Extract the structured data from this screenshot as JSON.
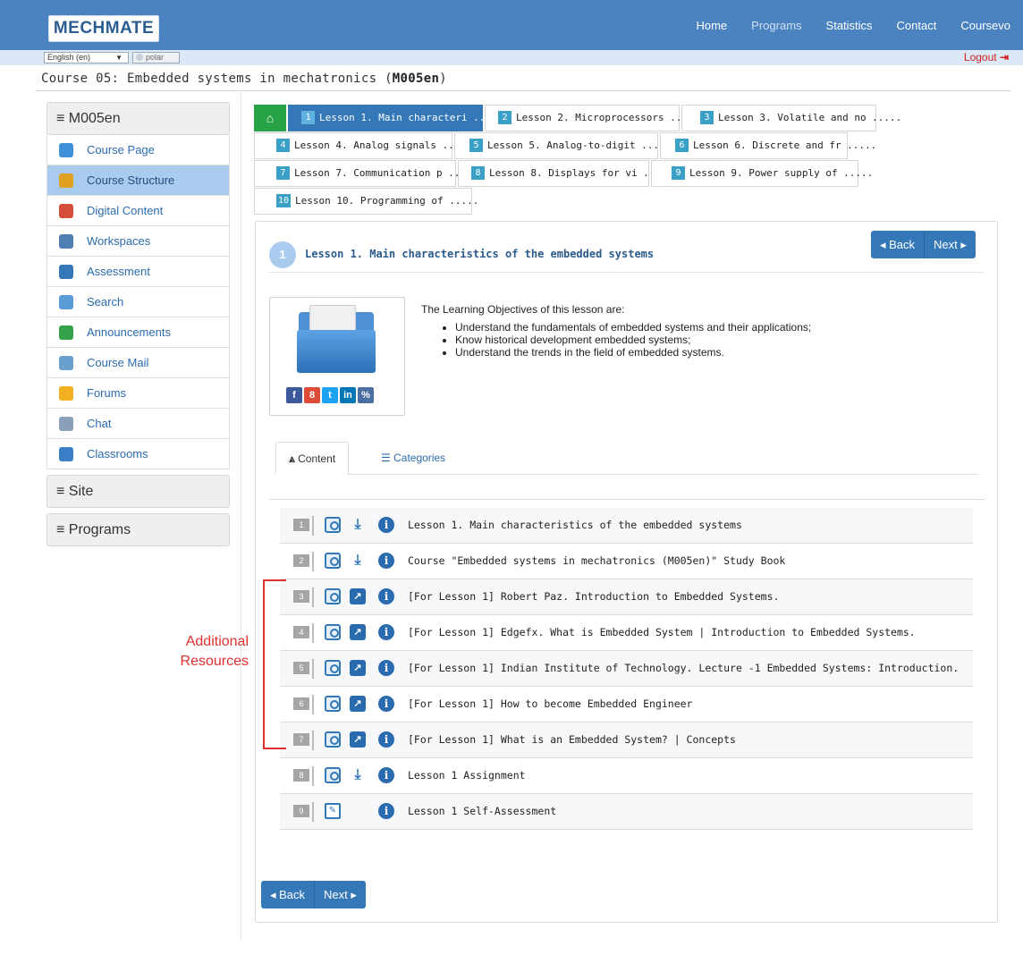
{
  "header": {
    "logo_part1": "MECH",
    "logo_part2": "MATE",
    "nav": [
      "Home",
      "Programs",
      "Statistics",
      "Contact",
      "Coursevo"
    ]
  },
  "subbar": {
    "language": "English (en)",
    "theme": "polar",
    "logout": "Logout"
  },
  "course": {
    "title_prefix": "Course 05: Embedded systems in mechatronics (",
    "code": "M005en",
    "title_suffix": ")"
  },
  "sidebar": {
    "course_header": "≡ M005en",
    "items": [
      {
        "label": "Course Page",
        "icon_color": "#3d8fd6"
      },
      {
        "label": "Course Structure",
        "icon_color": "#e0a020"
      },
      {
        "label": "Digital Content",
        "icon_color": "#d44f3a"
      },
      {
        "label": "Workspaces",
        "icon_color": "#4e7fb3"
      },
      {
        "label": "Assessment",
        "icon_color": "#3478b8"
      },
      {
        "label": "Search",
        "icon_color": "#5a9bd6"
      },
      {
        "label": "Announcements",
        "icon_color": "#35a04a"
      },
      {
        "label": "Course Mail",
        "icon_color": "#6aa0d0"
      },
      {
        "label": "Forums",
        "icon_color": "#f0b020"
      },
      {
        "label": "Chat",
        "icon_color": "#8aa0b8"
      },
      {
        "label": "Classrooms",
        "icon_color": "#3a7ec6"
      }
    ],
    "site_header": "≡ Site",
    "programs_header": "≡ Programs"
  },
  "lesson_tabs": [
    {
      "num": "1",
      "label": "Lesson 1. Main characteri ....."
    },
    {
      "num": "2",
      "label": "Lesson 2. Microprocessors ....."
    },
    {
      "num": "3",
      "label": "Lesson 3. Volatile and no ....."
    },
    {
      "num": "4",
      "label": "Lesson 4. Analog signals ....."
    },
    {
      "num": "5",
      "label": "Lesson 5. Analog-to-digit ....."
    },
    {
      "num": "6",
      "label": "Lesson 6. Discrete and fr ....."
    },
    {
      "num": "7",
      "label": "Lesson 7. Communication p ....."
    },
    {
      "num": "8",
      "label": "Lesson 8. Displays for vi ....."
    },
    {
      "num": "9",
      "label": "Lesson 9. Power supply of ....."
    },
    {
      "num": "10",
      "label": "Lesson 10. Programming of ....."
    }
  ],
  "lesson": {
    "badge": "1",
    "title": "Lesson 1. Main characteristics of the embedded systems",
    "back": "◂ Back",
    "next": "Next ▸",
    "objectives_intro": "The Learning Objectives of this lesson are:",
    "objectives": [
      "Understand the fundamentals of embedded systems and their applications;",
      "Know historical development embedded systems;",
      "Understand the trends in the field of embedded systems."
    ],
    "socials": [
      {
        "glyph": "f",
        "color": "#3b5998",
        "name": "facebook-icon"
      },
      {
        "glyph": "8",
        "color": "#dd4b39",
        "name": "google-plus-icon"
      },
      {
        "glyph": "t",
        "color": "#1da1f2",
        "name": "twitter-icon"
      },
      {
        "glyph": "in",
        "color": "#0077b5",
        "name": "linkedin-icon"
      },
      {
        "glyph": "%",
        "color": "#4a6fa0",
        "name": "link-icon"
      }
    ]
  },
  "content_tabs": {
    "content": "Content",
    "categories": "Categories"
  },
  "resources": [
    {
      "num": "1",
      "text": "Lesson 1. Main characteristics of the embedded systems",
      "kind": "download"
    },
    {
      "num": "2",
      "text": "Course \"Embedded systems in mechatronics (M005en)\" Study Book",
      "kind": "download"
    },
    {
      "num": "3",
      "text": "[For Lesson 1] Robert Paz. Introduction to Embedded Systems.",
      "kind": "external"
    },
    {
      "num": "4",
      "text": "[For Lesson 1] Edgefx. What is Embedded System | Introduction to Embedded Systems.",
      "kind": "external"
    },
    {
      "num": "5",
      "text": "[For Lesson 1] Indian Institute of Technology. Lecture -1 Embedded Systems: Introduction.",
      "kind": "external"
    },
    {
      "num": "6",
      "text": "[For Lesson 1] How to become Embedded Engineer",
      "kind": "external"
    },
    {
      "num": "7",
      "text": "[For Lesson 1] What is an Embedded System? | Concepts",
      "kind": "external"
    },
    {
      "num": "8",
      "text": "Lesson 1 Assignment",
      "kind": "download"
    },
    {
      "num": "9",
      "text": "Lesson 1 Self-Assessment",
      "kind": "self"
    }
  ],
  "annotation": {
    "line1": "Additional",
    "line2": "Resources",
    "color": "#e03030"
  }
}
